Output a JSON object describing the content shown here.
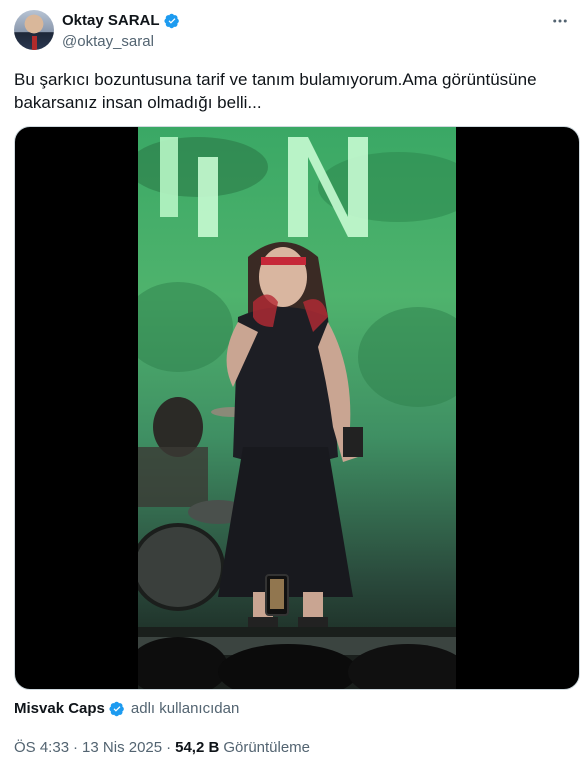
{
  "author": {
    "name": "Oktay SARAL",
    "handle": "@oktay_saral",
    "verified_color": "#1d9bf0"
  },
  "tweet": {
    "text": "Bu şarkıcı bozuntusuna tarif ve tanım bulamıyorum.Ama görüntüsüne bakarsanız insan olmadığı belli..."
  },
  "media": {
    "type": "video"
  },
  "source": {
    "name": "Misvak Caps",
    "suffix": "adlı kullanıcıdan"
  },
  "meta": {
    "time": "ÖS 4:33",
    "separator": "·",
    "date": "13 Nis 2025",
    "views_count": "54,2 B",
    "views_label": "Görüntüleme"
  },
  "icons": {
    "more": "more-horizontal-icon",
    "verified": "verified-badge-icon"
  }
}
